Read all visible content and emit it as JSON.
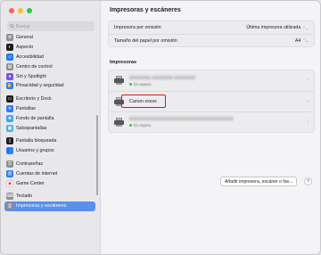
{
  "sidebar": {
    "search_placeholder": "Buscar",
    "groups": [
      [
        {
          "label": "General",
          "color": "#8e8e93",
          "icon": "gear-icon",
          "glyph": "⚙"
        },
        {
          "label": "Aspecto",
          "color": "#1d1d1f",
          "icon": "appearance-icon",
          "glyph": "◐"
        },
        {
          "label": "Accesibilidad",
          "color": "#1a7cf5",
          "icon": "accessibility-icon",
          "glyph": "☺"
        },
        {
          "label": "Centro de control",
          "color": "#8e8e93",
          "icon": "control-center-icon",
          "glyph": "▤"
        },
        {
          "label": "Siri y Spotlight",
          "color": "#7a52e0",
          "icon": "siri-icon",
          "glyph": "●"
        },
        {
          "label": "Privacidad y seguridad",
          "color": "#2f7cf6",
          "icon": "hand-icon",
          "glyph": "✋"
        }
      ],
      [
        {
          "label": "Escritorio y Dock",
          "color": "#1d1d1f",
          "icon": "dock-icon",
          "glyph": "▭"
        },
        {
          "label": "Pantallas",
          "color": "#2f7cf6",
          "icon": "display-icon",
          "glyph": "☀"
        },
        {
          "label": "Fondo de pantalla",
          "color": "#3fa7e8",
          "icon": "wallpaper-icon",
          "glyph": "❀"
        },
        {
          "label": "Salvapantallas",
          "color": "#49b7d9",
          "icon": "screensaver-icon",
          "glyph": "▣"
        }
      ],
      [
        {
          "label": "Pantalla bloqueada",
          "color": "#1d1d1f",
          "icon": "lock-screen-icon",
          "glyph": "▯"
        },
        {
          "label": "Usuarios y grupos",
          "color": "#2f7cf6",
          "icon": "users-icon",
          "glyph": "👥"
        }
      ],
      [
        {
          "label": "Contraseñas",
          "color": "#8e8e93",
          "icon": "key-icon",
          "glyph": "⚿"
        },
        {
          "label": "Cuentas de internet",
          "color": "#2f7cf6",
          "icon": "at-icon",
          "glyph": "@"
        },
        {
          "label": "Game Center",
          "color": "#ffffff",
          "icon": "game-center-icon",
          "glyph": "◉"
        }
      ],
      [
        {
          "label": "Teclado",
          "color": "#8e8e93",
          "icon": "keyboard-icon",
          "glyph": "⌨"
        },
        {
          "label": "Impresoras y escáneres",
          "color": "#8e8e93",
          "icon": "printer-icon",
          "glyph": "⎙",
          "active": true
        }
      ]
    ]
  },
  "main": {
    "title": "Impresoras y escáneres",
    "settings": [
      {
        "label": "Impresora por omisión",
        "value": "Última impresora utilizada"
      },
      {
        "label": "Tamaño del papel por omisión",
        "value": "A4"
      }
    ],
    "printers_title": "Impresoras",
    "printers": [
      {
        "name": "XXXXXX-XXXXXX-XXXXXX",
        "status": "En espera",
        "blurred": true
      },
      {
        "name": "Canon xxxxx",
        "status": "",
        "blurred": false,
        "highlighted": true
      },
      {
        "name": "XXXXXXXXXXXXXXXXXXXXXXXXXXXXXX",
        "status": "En espera",
        "blurred": true
      }
    ],
    "add_button": "Añadir impresora, escáner o fax...",
    "help_button": "?"
  }
}
